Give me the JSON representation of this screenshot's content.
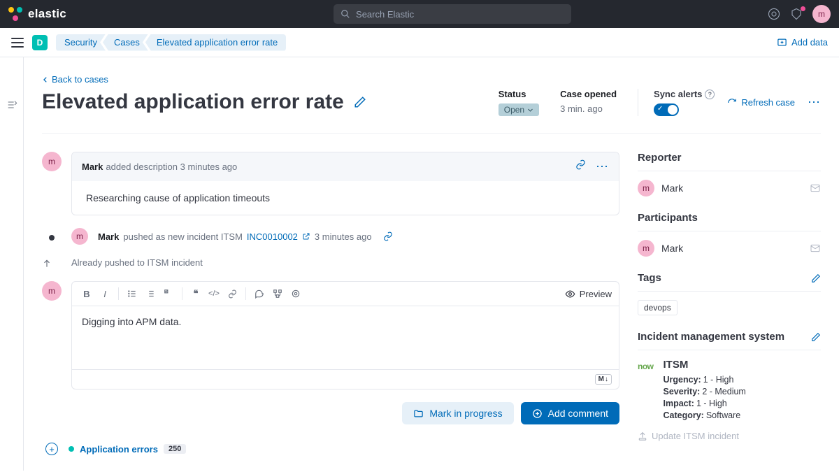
{
  "topbar": {
    "brand": "elastic",
    "search_placeholder": "Search Elastic",
    "avatar_initial": "m"
  },
  "header": {
    "space": "D",
    "crumbs": [
      "Security",
      "Cases",
      "Elevated application error rate"
    ],
    "add_data": "Add data"
  },
  "case": {
    "back": "Back to cases",
    "title": "Elevated application error rate",
    "status_label": "Status",
    "status_value": "Open",
    "opened_label": "Case opened",
    "opened_value": "3 min. ago",
    "sync_label": "Sync alerts",
    "refresh": "Refresh case"
  },
  "activity": {
    "a1_user": "Mark",
    "a1_action": "added description 3 minutes ago",
    "a1_body": "Researching cause of application timeouts",
    "a2_user": "Mark",
    "a2_action": "pushed as new incident ITSM",
    "a2_link": "INC0010002",
    "a2_time": "3 minutes ago",
    "push_note": "Already pushed to ITSM incident",
    "editor_value": "Digging into APM data.",
    "preview": "Preview",
    "mark_progress": "Mark in progress",
    "add_comment": "Add comment",
    "avatar_initial": "m"
  },
  "side": {
    "reporter_title": "Reporter",
    "reporter_name": "Mark",
    "participants_title": "Participants",
    "participant_name": "Mark",
    "tags_title": "Tags",
    "tag": "devops",
    "ims_title": "Incident management system",
    "itsm_name": "ITSM",
    "urgency_k": "Urgency:",
    "urgency_v": "1 - High",
    "severity_k": "Severity:",
    "severity_v": "2 - Medium",
    "impact_k": "Impact:",
    "impact_v": "1 - High",
    "category_k": "Category:",
    "category_v": "Software",
    "update": "Update ITSM incident"
  },
  "footer": {
    "label": "Application errors",
    "count": "250"
  }
}
